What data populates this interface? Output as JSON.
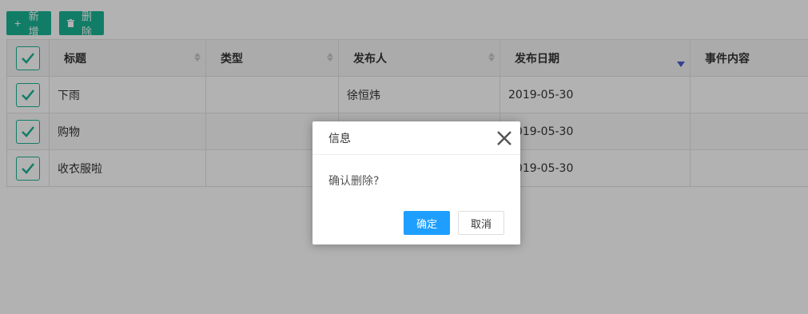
{
  "toolbar": {
    "add_label": "新增",
    "delete_label": "删除"
  },
  "table": {
    "columns": [
      "标题",
      "类型",
      "发布人",
      "发布日期",
      "事件内容"
    ],
    "rows": [
      {
        "title": "下雨",
        "type": "",
        "publisher": "徐恒炜",
        "date": "2019-05-30",
        "content": ""
      },
      {
        "title": "购物",
        "type": "",
        "publisher": "",
        "date": "2019-05-30",
        "content": ""
      },
      {
        "title": "收衣服啦",
        "type": "",
        "publisher": "",
        "date": "2019-05-30",
        "content": ""
      }
    ],
    "sort_column": "发布日期",
    "sort_direction": "desc"
  },
  "dialog": {
    "title": "信息",
    "message": "确认删除?",
    "ok_label": "确定",
    "cancel_label": "取消"
  },
  "colors": {
    "accent": "#1ab394",
    "primary": "#1e9fff",
    "sort_active": "#4b5fd1"
  }
}
